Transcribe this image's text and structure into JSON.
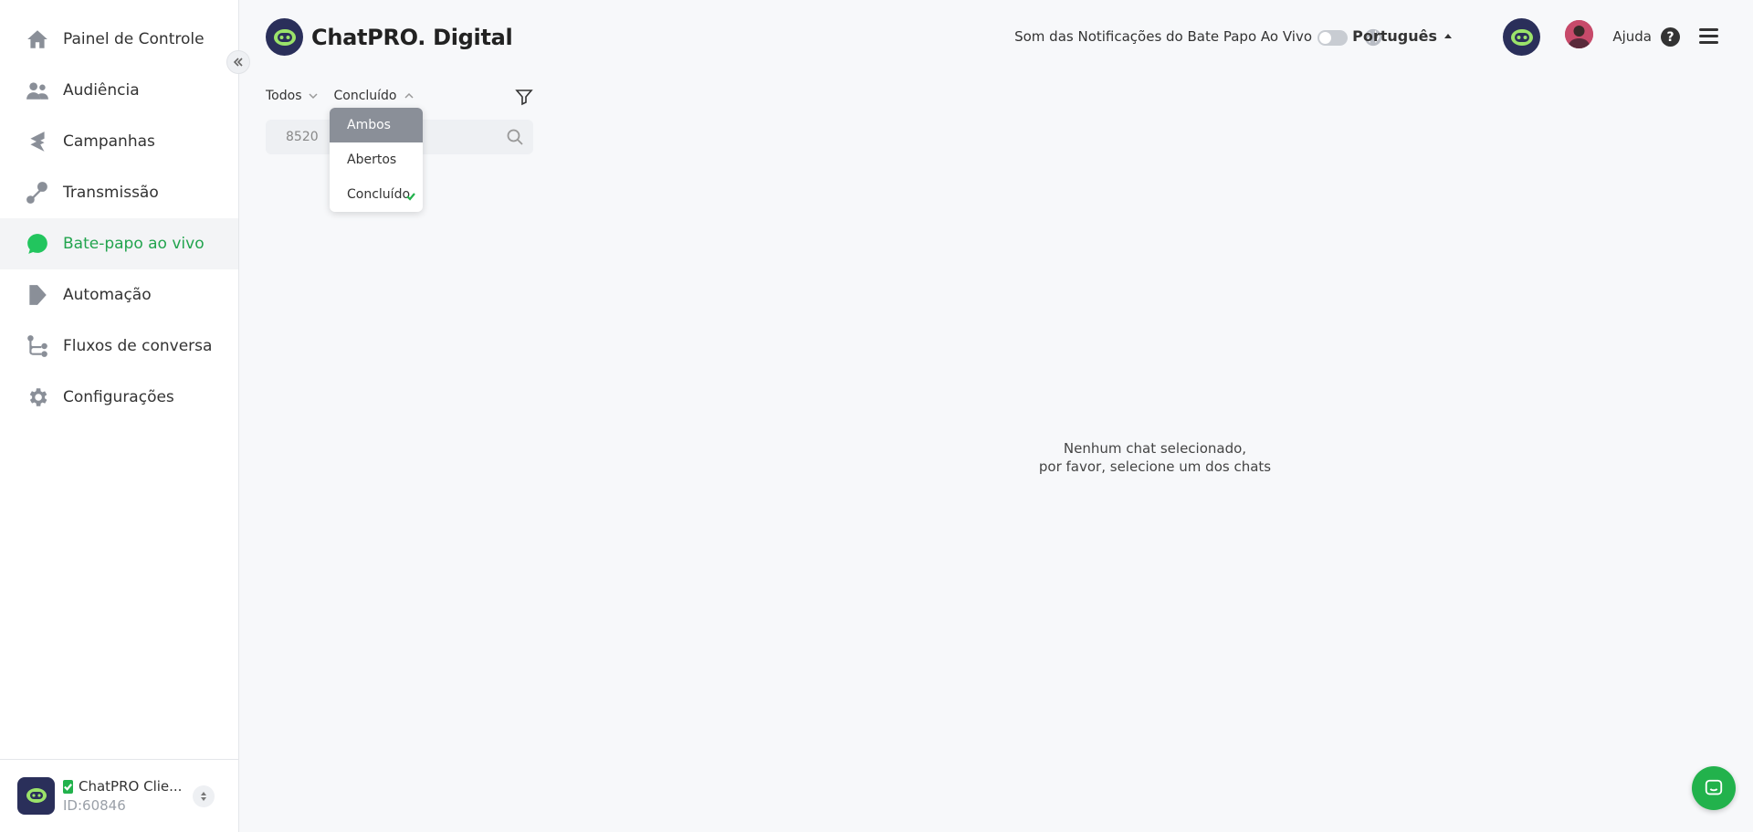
{
  "sidebar": {
    "items": [
      {
        "label": "Painel de Controle",
        "icon": "home-icon"
      },
      {
        "label": "Audiência",
        "icon": "users-icon"
      },
      {
        "label": "Campanhas",
        "icon": "campaign-icon"
      },
      {
        "label": "Transmissão",
        "icon": "broadcast-icon"
      },
      {
        "label": "Bate-papo ao vivo",
        "icon": "chat-icon",
        "active": true
      },
      {
        "label": "Automação",
        "icon": "automation-icon"
      },
      {
        "label": "Fluxos de conversa",
        "icon": "flow-icon"
      },
      {
        "label": "Configurações",
        "icon": "gear-icon"
      }
    ],
    "account": {
      "name": "ChatPRO Clie...",
      "id": "ID:60846"
    }
  },
  "header": {
    "brand": "ChatPRO. Digital",
    "notification_label": "Som das Notificações do Bate Papo Ao Vivo",
    "language": "Português",
    "help_label": "Ajuda"
  },
  "chat_list": {
    "filter_scope": "Todos",
    "filter_status": "Concluído",
    "search_value": "8520",
    "status_options": [
      {
        "label": "Ambos"
      },
      {
        "label": "Abertos"
      },
      {
        "label": "Concluído",
        "selected": true
      }
    ]
  },
  "empty_state": {
    "line1": "Nenhum chat selecionado,",
    "line2": "por favor, selecione um dos chats"
  },
  "colors": {
    "accent": "#22c55e",
    "brand_dark": "#2a2f5a"
  }
}
